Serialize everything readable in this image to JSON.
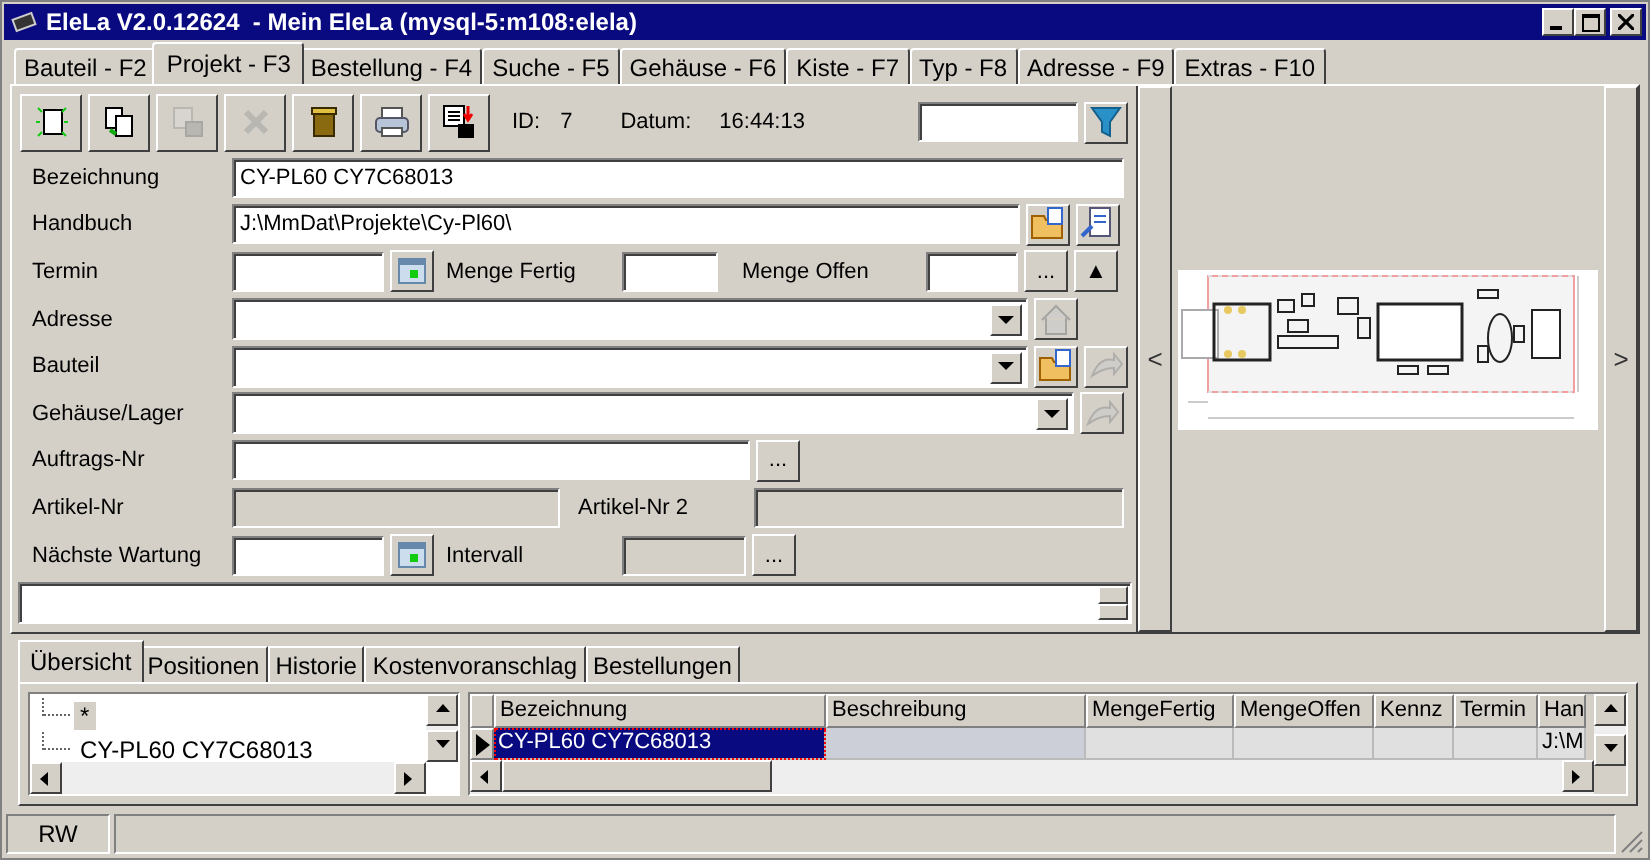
{
  "window": {
    "title": "EleLa V2.0.12624  - Mein EleLa (mysql-5:m108:elela)"
  },
  "tabs": [
    {
      "label": "Bauteil - F2",
      "selected": false
    },
    {
      "label": "Projekt - F3",
      "selected": true
    },
    {
      "label": "Bestellung - F4",
      "selected": false
    },
    {
      "label": "Suche - F5",
      "selected": false
    },
    {
      "label": "Gehäuse - F6",
      "selected": false
    },
    {
      "label": "Kiste - F7",
      "selected": false
    },
    {
      "label": "Typ - F8",
      "selected": false
    },
    {
      "label": "Adresse - F9",
      "selected": false
    },
    {
      "label": "Extras - F10",
      "selected": false
    }
  ],
  "toolbar": {
    "buttons": [
      {
        "kind": "new",
        "disabled": false
      },
      {
        "kind": "copy",
        "disabled": false
      },
      {
        "kind": "save",
        "disabled": true
      },
      {
        "kind": "delete",
        "disabled": true
      },
      {
        "kind": "bin",
        "disabled": false
      },
      {
        "kind": "print",
        "disabled": false
      },
      {
        "kind": "export",
        "disabled": false
      }
    ],
    "id_label": "ID:",
    "id_value": "7",
    "date_label": "Datum:",
    "date_value": "16:44:13"
  },
  "form": {
    "bezeichnung": {
      "label": "Bezeichnung",
      "value": "CY-PL60 CY7C68013"
    },
    "handbuch": {
      "label": "Handbuch",
      "value": "J:\\MmDat\\Projekte\\Cy-Pl60\\",
      "buttons": [
        {
          "kind": "folder",
          "disabled": false
        },
        {
          "kind": "document",
          "disabled": false
        }
      ]
    },
    "termin": {
      "label": "Termin"
    },
    "menge_fertig": {
      "label": "Menge Fertig"
    },
    "menge_offen": {
      "label": "Menge Offen",
      "more": "...",
      "toggle": "▲"
    },
    "adresse": {
      "label": "Adresse",
      "buttons": [
        {
          "kind": "house",
          "disabled": true
        }
      ]
    },
    "bauteil": {
      "label": "Bauteil",
      "buttons": [
        {
          "kind": "folder",
          "disabled": false
        },
        {
          "kind": "arrow",
          "disabled": true
        }
      ]
    },
    "gehaeuse": {
      "label": "Gehäuse/Lager",
      "buttons": [
        {
          "kind": "arrow",
          "disabled": true
        }
      ]
    },
    "auftrags_nr": {
      "label": "Auftrags-Nr",
      "more": "..."
    },
    "artikel_nr": {
      "label": "Artikel-Nr"
    },
    "artikel_nr_2": {
      "label": "Artikel-Nr 2"
    },
    "naechste_wartung": {
      "label": "Nächste Wartung"
    },
    "intervall": {
      "label": "Intervall",
      "more": "..."
    }
  },
  "image_panel": {
    "prev": "<",
    "next": ">"
  },
  "bottom_tabs": [
    {
      "label": "Übersicht",
      "selected": true
    },
    {
      "label": "Positionen",
      "selected": false
    },
    {
      "label": "Historie",
      "selected": false
    },
    {
      "label": "Kostenvoranschlag",
      "selected": false
    },
    {
      "label": "Bestellungen",
      "selected": false
    }
  ],
  "tree": {
    "items": [
      {
        "label": "*",
        "selected": true
      },
      {
        "label": "CY-PL60 CY7C68013",
        "selected": false
      }
    ]
  },
  "grid": {
    "columns": [
      "Bezeichnung",
      "Beschreibung",
      "MengeFertig",
      "MengeOffen",
      "Kennz",
      "Termin",
      "Han"
    ],
    "rows": [
      {
        "selected": true,
        "cells": [
          "CY-PL60 CY7C68013",
          "",
          "",
          "",
          "",
          "",
          "J:\\M"
        ]
      }
    ]
  },
  "status_bar": [
    "RW"
  ]
}
